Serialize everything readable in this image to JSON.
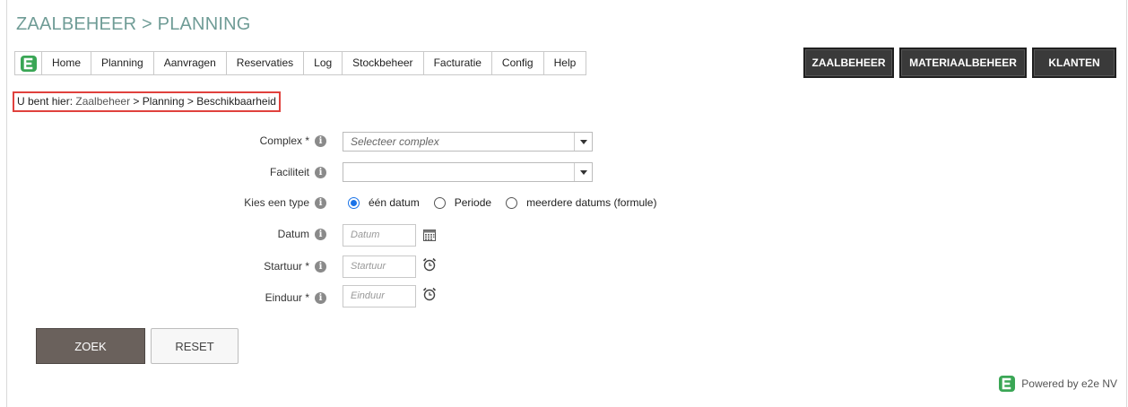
{
  "page_title": "ZAALBEHEER > PLANNING",
  "menu": [
    "Home",
    "Planning",
    "Aanvragen",
    "Reservaties",
    "Log",
    "Stockbeheer",
    "Facturatie",
    "Config",
    "Help"
  ],
  "top_buttons": {
    "zaalbeheer": "ZAALBEHEER",
    "materiaalbeheer": "MATERIAALBEHEER",
    "klanten": "KLANTEN"
  },
  "breadcrumb": {
    "prefix": "U bent hier: ",
    "zaalbeheer": "Zaalbeheer",
    "sep": " > ",
    "planning": "Planning",
    "current": "Beschikbaarheid"
  },
  "form": {
    "complex": {
      "label": "Complex *",
      "placeholder": "Selecteer complex"
    },
    "faciliteit": {
      "label": "Faciliteit",
      "value": ""
    },
    "type": {
      "label": "Kies een type",
      "options": [
        "één datum",
        "Periode",
        "meerdere datums (formule)"
      ],
      "selected": "één datum"
    },
    "datum": {
      "label": "Datum",
      "placeholder": "Datum"
    },
    "startuur": {
      "label": "Startuur *",
      "placeholder": "Startuur"
    },
    "einduur": {
      "label": "Einduur *",
      "placeholder": "Einduur"
    }
  },
  "actions": {
    "search": "ZOEK",
    "reset": "RESET"
  },
  "footer": {
    "powered": "Powered by e2e NV"
  },
  "colors": {
    "title": "#6f9c96",
    "brand_green": "#3aa655",
    "dark_button": "#3a3a3a",
    "search_button": "#6a615c",
    "highlight": "#e0413d",
    "radio_selected": "#1a73e8"
  },
  "icons": {
    "info": "info-circle-icon",
    "calendar": "calendar-icon",
    "clock": "alarm-clock-icon",
    "logo": "e2e-logo-icon"
  }
}
